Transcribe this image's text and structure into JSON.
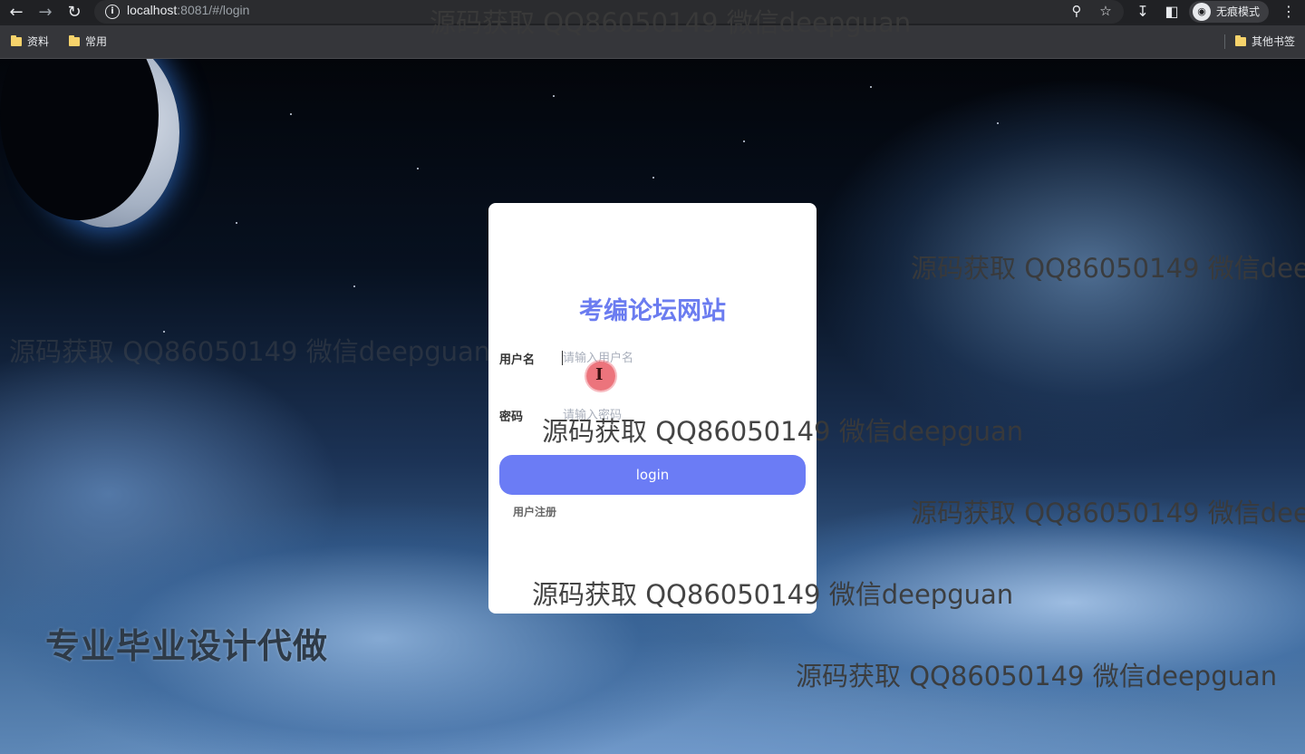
{
  "browser": {
    "url_host": "localhost",
    "url_rest": ":8081/#/login",
    "profile_label": "无痕模式",
    "bookmarks": [
      {
        "label": "资料"
      },
      {
        "label": "常用"
      }
    ],
    "other_bookmarks": "其他书签"
  },
  "login": {
    "title": "考编论坛网站",
    "username_label": "用户名",
    "username_placeholder": "请输入用户名",
    "password_label": "密码",
    "password_placeholder": "请输入密码",
    "login_button": "login",
    "register_link": "用户注册"
  },
  "overlay": {
    "watermark": "源码获取 QQ86050149 微信deepguan",
    "promo": "专业毕业设计代做"
  },
  "colors": {
    "accent": "#6b7cf5",
    "title": "#6b7cf0"
  }
}
